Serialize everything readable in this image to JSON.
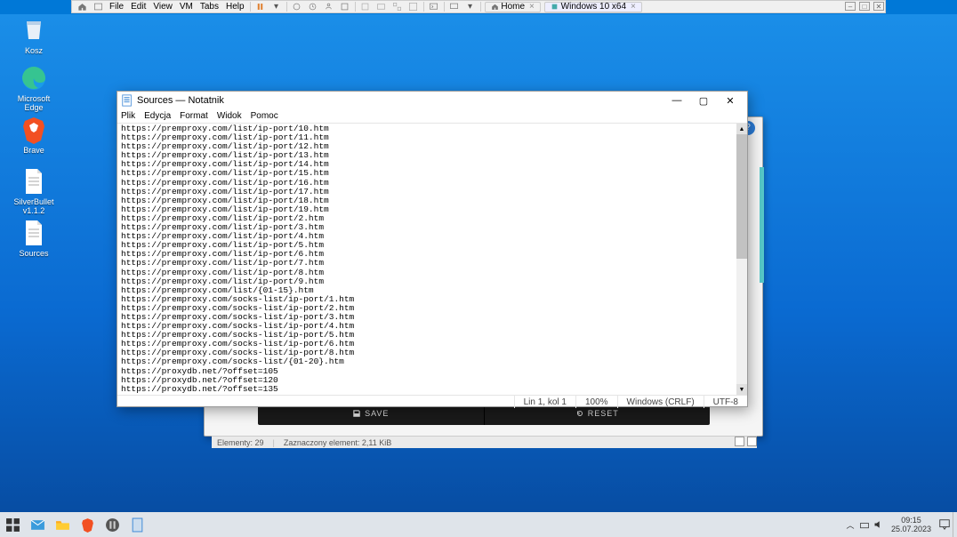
{
  "vm_toolbar": {
    "menus": [
      "File",
      "Edit",
      "View",
      "VM",
      "Tabs",
      "Help"
    ],
    "home": "Home",
    "tab": "Windows 10 x64"
  },
  "desktop_icons": {
    "bin": "Kosz",
    "edge": "Microsoft Edge",
    "brave": "Brave",
    "file1": "SilverBullet v1.1.2",
    "file2": "Sources"
  },
  "bgwin": {
    "save": "SAVE",
    "reset": "RESET",
    "status_left": "Elementy: 29",
    "status_right": "Zaznaczony element: 2,11 KiB"
  },
  "notepad": {
    "title": "Sources — Notatnik",
    "menus": [
      "Plik",
      "Edycja",
      "Format",
      "Widok",
      "Pomoc"
    ],
    "lines": [
      "https://premproxy.com/list/ip-port/10.htm",
      "https://premproxy.com/list/ip-port/11.htm",
      "https://premproxy.com/list/ip-port/12.htm",
      "https://premproxy.com/list/ip-port/13.htm",
      "https://premproxy.com/list/ip-port/14.htm",
      "https://premproxy.com/list/ip-port/15.htm",
      "https://premproxy.com/list/ip-port/16.htm",
      "https://premproxy.com/list/ip-port/17.htm",
      "https://premproxy.com/list/ip-port/18.htm",
      "https://premproxy.com/list/ip-port/19.htm",
      "https://premproxy.com/list/ip-port/2.htm",
      "https://premproxy.com/list/ip-port/3.htm",
      "https://premproxy.com/list/ip-port/4.htm",
      "https://premproxy.com/list/ip-port/5.htm",
      "https://premproxy.com/list/ip-port/6.htm",
      "https://premproxy.com/list/ip-port/7.htm",
      "https://premproxy.com/list/ip-port/8.htm",
      "https://premproxy.com/list/ip-port/9.htm",
      "https://premproxy.com/list/{01-15}.htm",
      "https://premproxy.com/socks-list/ip-port/1.htm",
      "https://premproxy.com/socks-list/ip-port/2.htm",
      "https://premproxy.com/socks-list/ip-port/3.htm",
      "https://premproxy.com/socks-list/ip-port/4.htm",
      "https://premproxy.com/socks-list/ip-port/5.htm",
      "https://premproxy.com/socks-list/ip-port/6.htm",
      "https://premproxy.com/socks-list/ip-port/8.htm",
      "https://premproxy.com/socks-list/{01-20}.htm",
      "https://proxydb.net/?offset=105",
      "https://proxydb.net/?offset=120",
      "https://proxydb.net/?offset=135"
    ],
    "status": {
      "pos": "Lin 1, kol 1",
      "zoom": "100%",
      "eol": "Windows (CRLF)",
      "enc": "UTF-8"
    }
  },
  "clock": {
    "time": "09:15",
    "date": "25.07.2023"
  }
}
